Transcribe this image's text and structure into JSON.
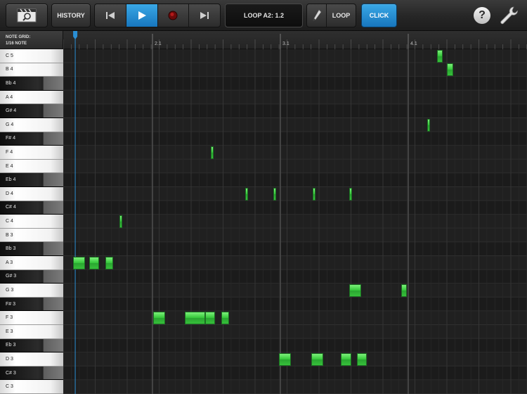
{
  "toolbar": {
    "history_label": "HISTORY",
    "loop_display": "LOOP A2: 1.2",
    "loop_label": "LOOP",
    "click_label": "CLICK",
    "help_label": "?",
    "accent_color": "#2a8fd4"
  },
  "icons": {
    "zoom": "magnifier-film-icon",
    "rewind": "skip-back-icon",
    "play": "play-icon",
    "record": "record-icon",
    "forward": "skip-forward-icon",
    "pencil": "pencil-icon",
    "settings": "wrench-icon"
  },
  "grid_header": {
    "line1": "NOTE GRID:",
    "line2": "1/16 NOTE"
  },
  "ruler": {
    "bars": [
      "2.1",
      "3.1",
      "4.1"
    ]
  },
  "piano_keys": [
    {
      "label": "C 5",
      "black": false
    },
    {
      "label": "B 4",
      "black": false
    },
    {
      "label": "Bb 4",
      "black": true
    },
    {
      "label": "A 4",
      "black": false
    },
    {
      "label": "G# 4",
      "black": true
    },
    {
      "label": "G 4",
      "black": false
    },
    {
      "label": "F# 4",
      "black": true
    },
    {
      "label": "F 4",
      "black": false
    },
    {
      "label": "E 4",
      "black": false
    },
    {
      "label": "Eb 4",
      "black": true
    },
    {
      "label": "D 4",
      "black": false
    },
    {
      "label": "C# 4",
      "black": true
    },
    {
      "label": "C 4",
      "black": false
    },
    {
      "label": "B 3",
      "black": false
    },
    {
      "label": "Bb 3",
      "black": true
    },
    {
      "label": "A 3",
      "black": false
    },
    {
      "label": "G# 3",
      "black": true
    },
    {
      "label": "G 3",
      "black": false
    },
    {
      "label": "F# 3",
      "black": true
    },
    {
      "label": "F 3",
      "black": false
    },
    {
      "label": "E 3",
      "black": false
    },
    {
      "label": "Eb 3",
      "black": true
    },
    {
      "label": "D 3",
      "black": false
    },
    {
      "label": "C# 3",
      "black": true
    },
    {
      "label": "C 3",
      "black": false
    }
  ],
  "notes": [
    {
      "pitch": "A 3",
      "start": 1.25,
      "length": 1.5
    },
    {
      "pitch": "A 3",
      "start": 3.25,
      "length": 1.25
    },
    {
      "pitch": "A 3",
      "start": 5.25,
      "length": 1
    },
    {
      "pitch": "C 4",
      "start": 7.0,
      "length": 0.25
    },
    {
      "pitch": "F 3",
      "start": 11.25,
      "length": 1.5
    },
    {
      "pitch": "F 3",
      "start": 15.25,
      "length": 2.5
    },
    {
      "pitch": "F 3",
      "start": 17.75,
      "length": 1.25
    },
    {
      "pitch": "F 3",
      "start": 19.75,
      "length": 1
    },
    {
      "pitch": "F 4",
      "start": 18.5,
      "length": 0.25
    },
    {
      "pitch": "D 3",
      "start": 27.0,
      "length": 1.5
    },
    {
      "pitch": "D 3",
      "start": 31.0,
      "length": 1.5
    },
    {
      "pitch": "D 3",
      "start": 34.75,
      "length": 1.25
    },
    {
      "pitch": "D 3",
      "start": 36.75,
      "length": 1.25
    },
    {
      "pitch": "D 4",
      "start": 22.75,
      "length": 0.25
    },
    {
      "pitch": "D 4",
      "start": 26.25,
      "length": 0.25
    },
    {
      "pitch": "D 4",
      "start": 31.25,
      "length": 0.25
    },
    {
      "pitch": "D 4",
      "start": 35.75,
      "length": 0.25
    },
    {
      "pitch": "G 3",
      "start": 35.75,
      "length": 1.5
    },
    {
      "pitch": "G 3",
      "start": 42.25,
      "length": 0.75
    },
    {
      "pitch": "G 4",
      "start": 45.5,
      "length": 0.25
    },
    {
      "pitch": "C 5",
      "start": 46.75,
      "length": 0.75
    },
    {
      "pitch": "B 4",
      "start": 48.0,
      "length": 0.75
    }
  ],
  "playhead_position": 1.5
}
